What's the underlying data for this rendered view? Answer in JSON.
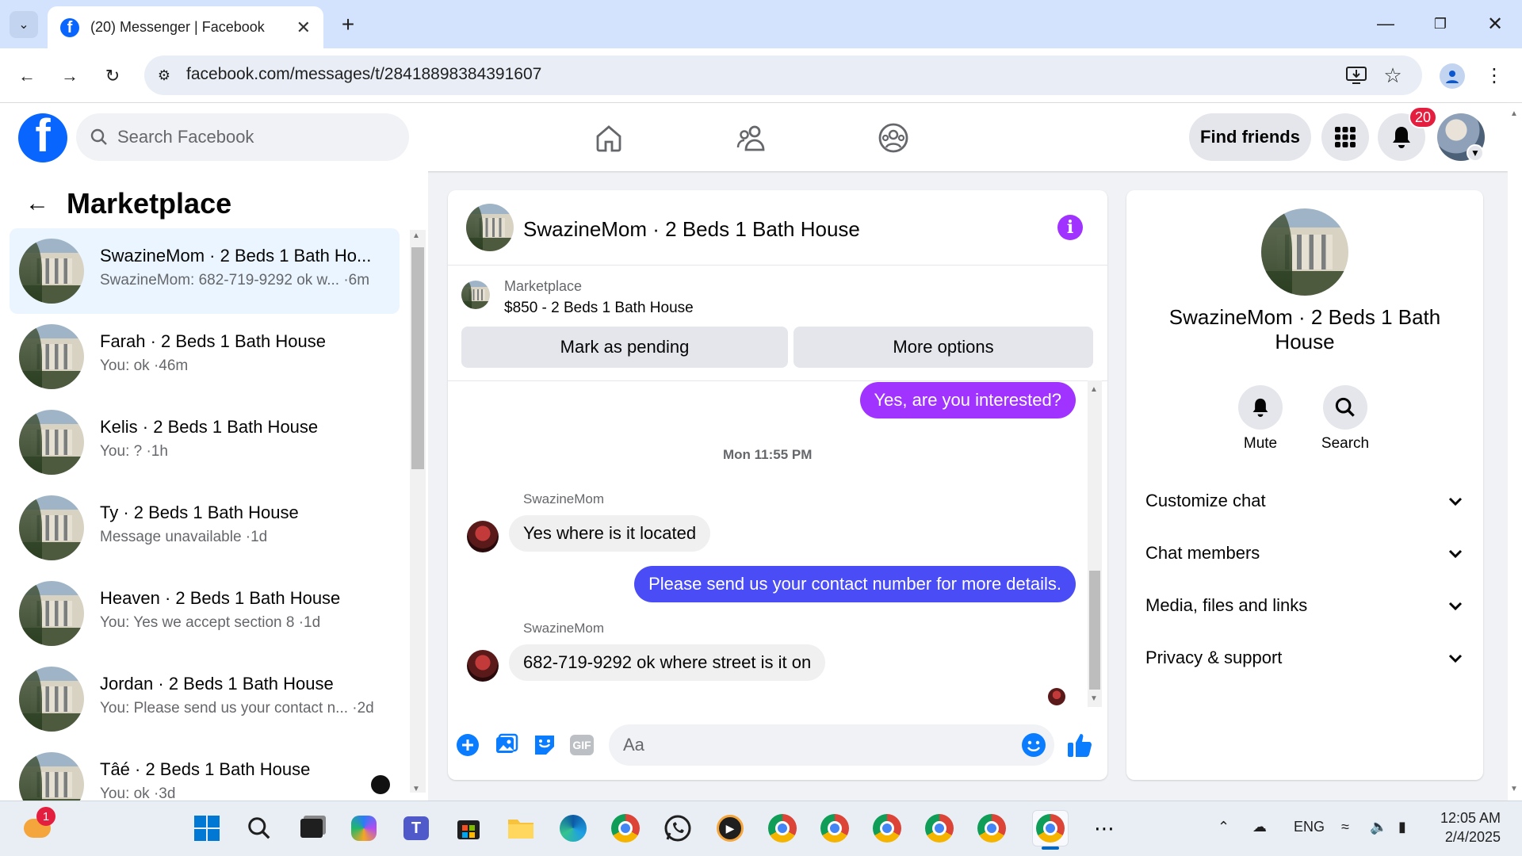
{
  "browser": {
    "tab_title": "(20) Messenger | Facebook",
    "url": "facebook.com/messages/t/28418898384391607"
  },
  "header": {
    "search_placeholder": "Search Facebook",
    "find_friends": "Find friends",
    "notification_count": "20"
  },
  "sidebar": {
    "title": "Marketplace",
    "conversations": [
      {
        "name": "SwazineMom · 2 Beds 1 Bath Ho...",
        "preview": "SwazineMom: 682-719-9292 ok w... ·6m",
        "active": true
      },
      {
        "name": "Farah · 2 Beds 1 Bath House",
        "preview": "You: ok ·46m"
      },
      {
        "name": "Kelis · 2 Beds 1 Bath House",
        "preview": "You: ? ·1h"
      },
      {
        "name": "Ty · 2 Beds 1 Bath House",
        "preview": "Message unavailable ·1d"
      },
      {
        "name": "Heaven · 2 Beds 1 Bath House",
        "preview": "You: Yes we accept section 8 ·1d"
      },
      {
        "name": "Jordan · 2 Beds 1 Bath House",
        "preview": "You: Please send us your contact n...  ·2d"
      },
      {
        "name": "Tâé · 2 Beds 1 Bath House",
        "preview": "You: ok ·3d"
      }
    ]
  },
  "chat": {
    "title": "SwazineMom · 2 Beds 1 Bath House",
    "listing_label": "Marketplace",
    "listing_title": "$850 - 2 Beds 1 Bath House",
    "mark_pending": "Mark as pending",
    "more_options": "More options",
    "messages": {
      "out1": "Yes, are you interested?",
      "timestamp": "Mon 11:55 PM",
      "sender1": "SwazineMom",
      "in1": "Yes where is it located",
      "out2": "Please send us your contact number for more details.",
      "sender2": "SwazineMom",
      "in2": "682-719-9292 ok where street is it on"
    },
    "composer_placeholder": "Aa"
  },
  "info_panel": {
    "name": "SwazineMom · 2 Beds 1 Bath House",
    "mute": "Mute",
    "search": "Search",
    "sections": [
      "Customize chat",
      "Chat members",
      "Media, files and links",
      "Privacy & support"
    ]
  },
  "taskbar": {
    "lang": "ENG",
    "time": "12:05 AM",
    "date": "2/4/2025",
    "badge": "1"
  },
  "colors": {
    "fb_blue": "#0866ff",
    "outgoing_bubble": "#0a7cff",
    "outgoing_bubble_alt": "#4a4cf5",
    "info_purple": "#a033ff",
    "active_conversation": "#ebf5ff"
  }
}
